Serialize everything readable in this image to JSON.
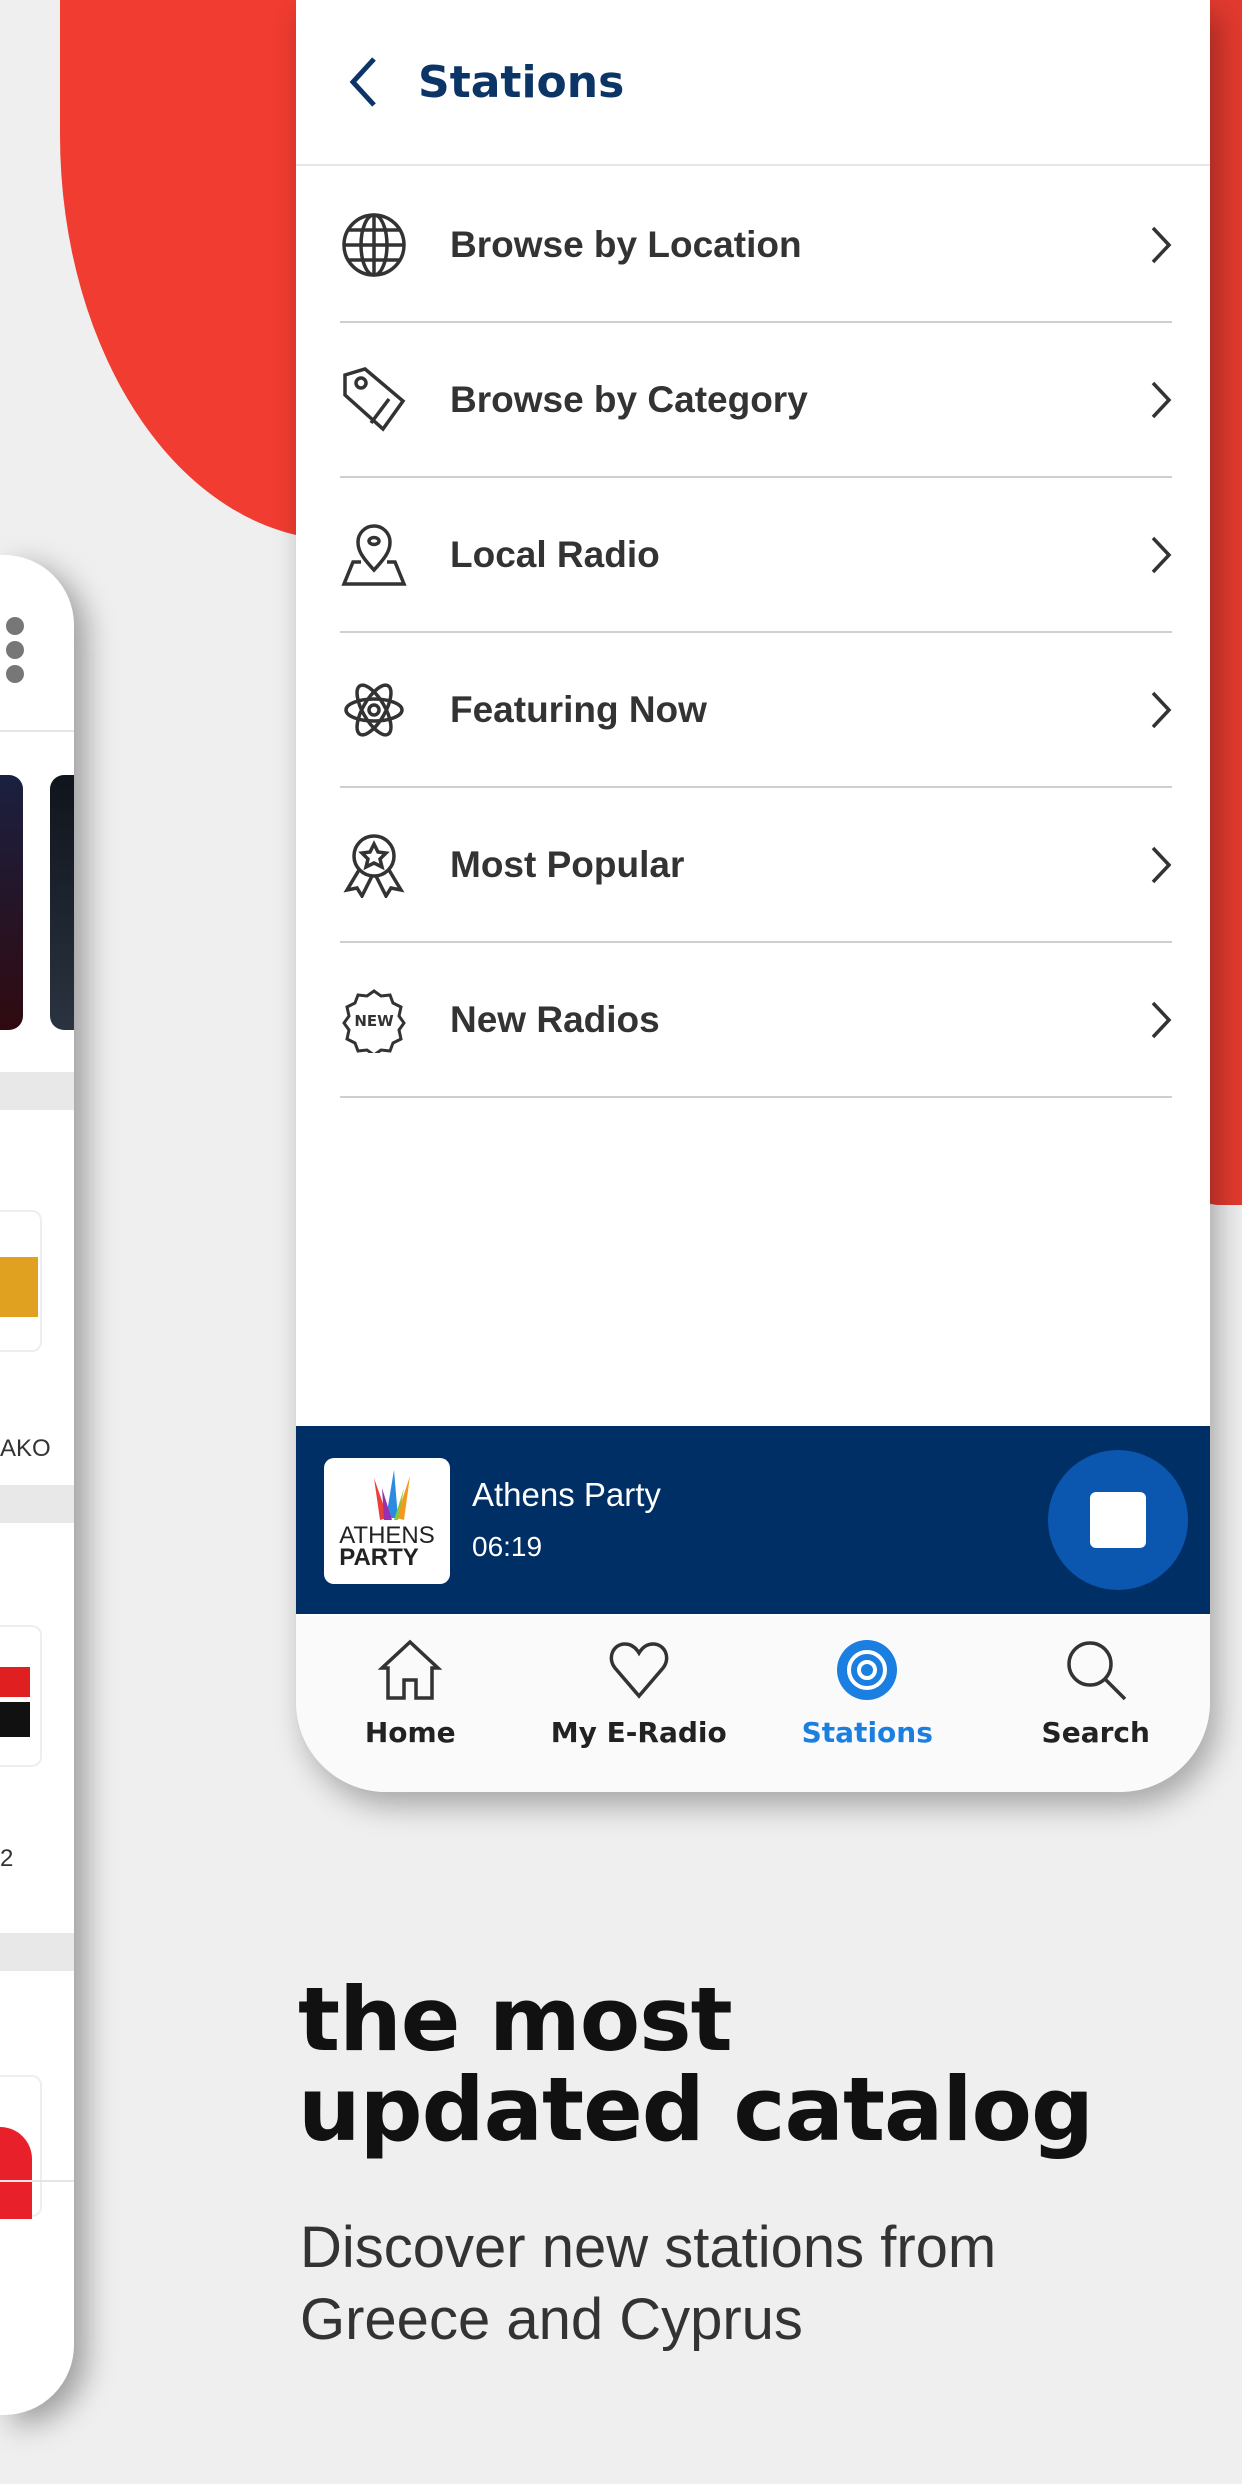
{
  "colors": {
    "accent_red": "#f03c31",
    "navy": "#002f66",
    "active_blue": "#1a7fe0"
  },
  "left_phone": {
    "partial_labels": [
      "AKO",
      "2"
    ]
  },
  "header": {
    "back_icon": "chevron-left-icon",
    "title": "Stations"
  },
  "menu": [
    {
      "icon": "globe-icon",
      "label": "Browse by Location"
    },
    {
      "icon": "tag-icon",
      "label": "Browse by Category"
    },
    {
      "icon": "map-pin-icon",
      "label": "Local Radio"
    },
    {
      "icon": "atom-icon",
      "label": "Featuring Now"
    },
    {
      "icon": "award-icon",
      "label": "Most Popular"
    },
    {
      "icon": "new-badge-icon",
      "label": "New Radios"
    }
  ],
  "player": {
    "station": "Athens Party",
    "time": "06:19",
    "logo_text": "ATHENS PARTY",
    "stop_icon": "stop-icon"
  },
  "nav": [
    {
      "icon": "home-icon",
      "label": "Home",
      "active": false
    },
    {
      "icon": "heart-icon",
      "label": "My E-Radio",
      "active": false
    },
    {
      "icon": "stations-icon",
      "label": "Stations",
      "active": true
    },
    {
      "icon": "search-icon",
      "label": "Search",
      "active": false
    }
  ],
  "promo": {
    "headline": "the most updated catalog",
    "subtitle": "Discover new stations from Greece and Cyprus"
  }
}
